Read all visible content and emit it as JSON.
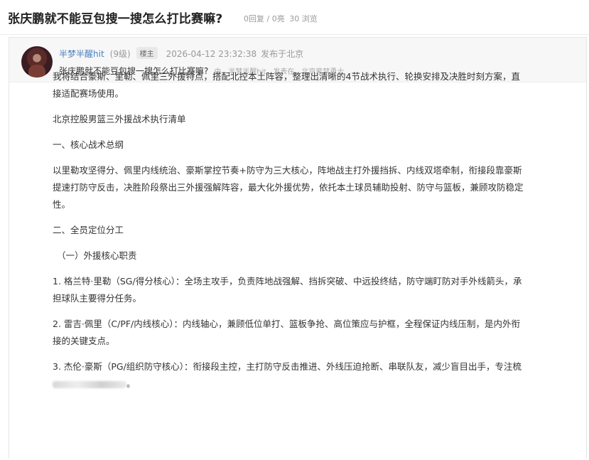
{
  "topic": {
    "title": "张庆鹏就不能豆包搜一搜怎么打比赛嘛?",
    "replies": "0回复",
    "likes": "0亮",
    "views": "30 浏览"
  },
  "post": {
    "author": "半梦半醒hit",
    "level": "(9级)",
    "badge": "楼主",
    "time": "2026-04-12 23:32:38",
    "location": "发布于北京",
    "subject": "张庆鹏就不能豆包搜一搜怎么打比赛嘛?",
    "subject_by": "由",
    "subject_author": "半梦半醒hit",
    "subject_posted_in": "发表在",
    "subject_board": "北京紫禁勇士"
  },
  "body": {
    "intro_line1": "我将结合豪斯、里勒、佩里三外援特点，搭配北控本土阵容，整理出清晰的4节战术执行、轮换安排及决胜时刻方案，直",
    "intro_line2": "接适配赛场使用。",
    "doc_title": "北京控股男篮三外援战术执行清单",
    "section1": "一、核心战术总纲",
    "core_line1": "以里勒攻坚得分、佩里内线统治、豪斯掌控节奏+防守为三大核心，阵地战主打外援挡拆、内线双塔牵制，衔接段靠豪斯",
    "core_line2": "提速打防守反击，决胜阶段祭出三外援强解阵容，最大化外援优势，依托本土球员辅助投射、防守与篮板，兼顾攻防稳定",
    "core_line3": "性。",
    "section2": "二、全员定位分工",
    "subsection1": "（一）外援核心职责",
    "item1_line1": "1. 格兰特·里勒（SG/得分核心）：全场主攻手，负责阵地战强解、挡拆突破、中远投终结，防守端盯防对手外线箭头，承",
    "item1_line2": "担球队主要得分任务。",
    "item2_line1": "2. 雷吉·佩里（C/PF/内线核心）：内线轴心，兼顾低位单打、篮板争抢、高位策应与护框，全程保证内线压制，是内外衔",
    "item2_line2": "接的关键支点。",
    "item3_line1": "3. 杰伦·豪斯（PG/组织防守核心）：衔接段主控，主打防守反击推进、外线压迫抢断、串联队友，减少盲目出手，专注梳",
    "item3_line2_end": "。"
  }
}
